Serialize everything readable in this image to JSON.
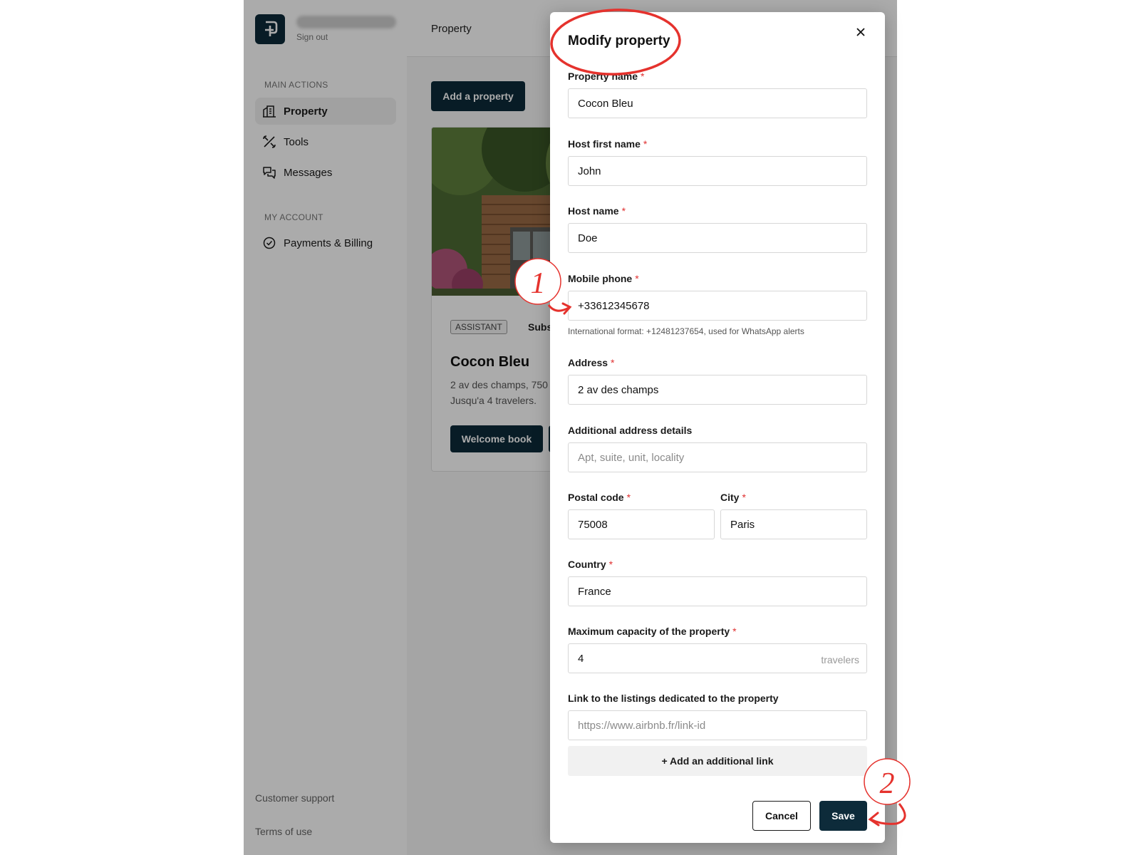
{
  "sidebar": {
    "sign_out": "Sign out",
    "sections": {
      "main_actions": "MAIN ACTIONS",
      "my_account": "MY ACCOUNT"
    },
    "items": [
      {
        "label": "Property",
        "icon": "building-icon",
        "active": true
      },
      {
        "label": "Tools",
        "icon": "tools-icon",
        "active": false
      },
      {
        "label": "Messages",
        "icon": "chat-icon",
        "active": false
      },
      {
        "label": "Payments & Billing",
        "icon": "badge-check-icon",
        "active": false
      }
    ],
    "footer": {
      "support": "Customer support",
      "terms": "Terms of use"
    }
  },
  "header": {
    "title": "Property"
  },
  "main": {
    "add_button": "Add a property",
    "card": {
      "badge": "ASSISTANT",
      "subscription": "Subs",
      "title": "Cocon Bleu",
      "address": "2 av des champs, 750",
      "capacity": "Jusqu'a 4 travelers.",
      "welcome_button": "Welcome book"
    }
  },
  "modal": {
    "title": "Modify property",
    "fields": {
      "property_name": {
        "label": "Property name",
        "value": "Cocon Bleu"
      },
      "host_first_name": {
        "label": "Host first name",
        "value": "John"
      },
      "host_name": {
        "label": "Host name",
        "value": "Doe"
      },
      "mobile_phone": {
        "label": "Mobile phone",
        "value": "+33612345678",
        "hint": "International format: +12481237654, used for WhatsApp alerts"
      },
      "address": {
        "label": "Address",
        "value": "2 av des champs"
      },
      "additional_address": {
        "label": "Additional address details",
        "placeholder": "Apt, suite, unit, locality"
      },
      "postal_code": {
        "label": "Postal code",
        "value": "75008"
      },
      "city": {
        "label": "City",
        "value": "Paris"
      },
      "country": {
        "label": "Country",
        "value": "France"
      },
      "max_capacity": {
        "label": "Maximum capacity of the property",
        "value": "4",
        "suffix": "travelers"
      },
      "listing_link": {
        "label": "Link to the listings dedicated to the property",
        "placeholder": "https://www.airbnb.fr/link-id"
      }
    },
    "required_mark": "*",
    "add_link_button": "+ Add an additional link",
    "cancel_button": "Cancel",
    "save_button": "Save"
  },
  "annotations": {
    "step1": "1",
    "step2": "2",
    "color": "#e5322d"
  },
  "colors": {
    "primary": "#0d2b3a",
    "required": "#e03030"
  }
}
